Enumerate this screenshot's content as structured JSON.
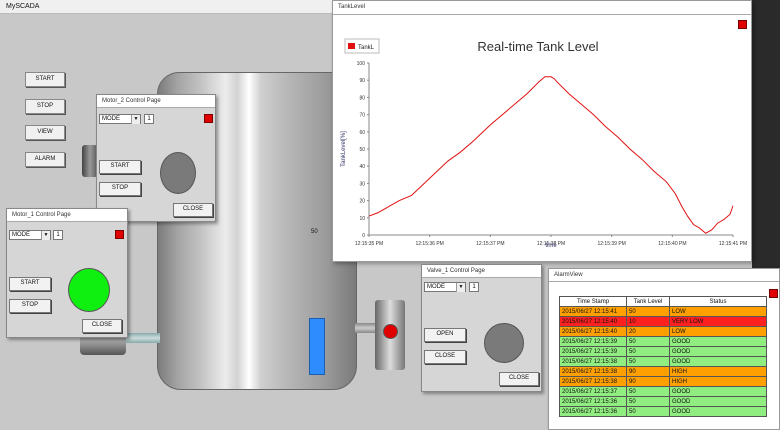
{
  "app": {
    "title": "MySCADA"
  },
  "controls": [
    "START",
    "STOP",
    "VIEW",
    "ALARM"
  ],
  "motor2": {
    "title": "Motor_2 Control Page",
    "mode": "MODE",
    "number": "1",
    "start": "START",
    "stop": "STOP",
    "close": "CLOSE",
    "status_color": "#7a7a7a"
  },
  "motor1": {
    "title": "Motor_1 Control Page",
    "mode": "MODE",
    "number": "1",
    "start": "START",
    "stop": "STOP",
    "close": "CLOSE",
    "status_color": "#10f010"
  },
  "valve": {
    "title": "Valve_1 Control Page",
    "mode": "MODE",
    "number": "1",
    "open": "OPEN",
    "close_valve": "CLOSE",
    "close": "CLOSE",
    "status_color": "#7a7a7a"
  },
  "tank": {
    "label": "50",
    "level_color": "#2f8cff"
  },
  "trend": {
    "window_title": "TankLevel",
    "chart_data": {
      "type": "line",
      "title": "Real-time Tank Level",
      "legend": [
        "TankL"
      ],
      "legend_position": "top-left",
      "xlabel": "time",
      "ylabel": "TankLevel[%]",
      "ylim": [
        0,
        100
      ],
      "yticks": [
        "100",
        "90",
        "80",
        "70",
        "60",
        "50",
        "40",
        "30",
        "20",
        "10",
        "0"
      ],
      "xticks": [
        "12:15:35 PM",
        "12:15:36 PM",
        "12:15:37 PM",
        "12:15:38 PM",
        "12:15:39 PM",
        "12:15:40 PM",
        "12:15:41 PM"
      ],
      "grid": false,
      "series": [
        {
          "name": "TankL",
          "color": "#e01010",
          "x": [
            0,
            0.15,
            0.3,
            0.5,
            0.7,
            0.85,
            1.0,
            1.15,
            1.3,
            1.5,
            1.7,
            1.85,
            2.0,
            2.2,
            2.4,
            2.6,
            2.8,
            2.9,
            3.0,
            3.05,
            3.1,
            3.3,
            3.5,
            3.7,
            3.9,
            4.1,
            4.3,
            4.5,
            4.7,
            4.9,
            5.05,
            5.15,
            5.25,
            5.35,
            5.45,
            5.55,
            5.65,
            5.75,
            5.85,
            5.95,
            6.0
          ],
          "y": [
            11,
            13,
            16,
            20,
            23,
            28,
            33,
            38,
            43,
            48,
            54,
            59,
            64,
            70,
            76,
            82,
            89,
            92,
            92,
            91,
            89,
            82,
            76,
            70,
            63,
            57,
            50,
            44,
            37,
            31,
            24,
            17,
            11,
            6,
            4,
            1,
            3,
            7,
            9,
            12,
            17
          ]
        }
      ]
    }
  },
  "alarms": {
    "window_title": "AlarmView",
    "columns": [
      "Time Stamp",
      "Tank Level",
      "Status"
    ],
    "rows": [
      {
        "time": "2015/06/27 12:15:41",
        "level": "50",
        "status": "LOW",
        "color": "#ffa000"
      },
      {
        "time": "2015/06/27 12:15:40",
        "level": "10",
        "status": "VERY LOW",
        "color": "#ff2020"
      },
      {
        "time": "2015/06/27 12:15:40",
        "level": "20",
        "status": "LOW",
        "color": "#ffa000"
      },
      {
        "time": "2015/06/27 12:15:39",
        "level": "50",
        "status": "GOOD",
        "color": "#90ee80"
      },
      {
        "time": "2015/06/27 12:15:39",
        "level": "50",
        "status": "GOOD",
        "color": "#90ee80"
      },
      {
        "time": "2015/06/27 12:15:38",
        "level": "50",
        "status": "GOOD",
        "color": "#90ee80"
      },
      {
        "time": "2015/06/27 12:15:38",
        "level": "90",
        "status": "HIGH",
        "color": "#ffa000"
      },
      {
        "time": "2015/06/27 12:15:38",
        "level": "90",
        "status": "HIGH",
        "color": "#ffa000"
      },
      {
        "time": "2015/06/27 12:15:37",
        "level": "50",
        "status": "GOOD",
        "color": "#90ee80"
      },
      {
        "time": "2015/06/27 12:15:36",
        "level": "50",
        "status": "GOOD",
        "color": "#90ee80"
      },
      {
        "time": "2015/06/27 12:15:36",
        "level": "50",
        "status": "GOOD",
        "color": "#90ee80"
      }
    ]
  }
}
